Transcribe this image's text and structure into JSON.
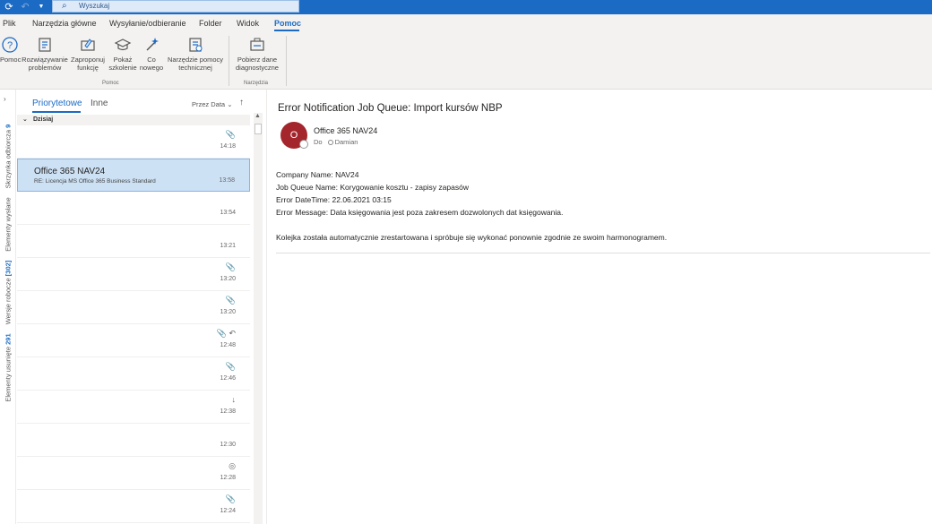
{
  "titlebar": {
    "search_placeholder": "Wyszukaj",
    "icons": [
      "sync-icon",
      "undo-icon",
      "qat-dropdown-icon"
    ]
  },
  "menu": {
    "tabs": [
      "Plik",
      "Narzędzia główne",
      "Wysyłanie/odbieranie",
      "Folder",
      "Widok",
      "Pomoc"
    ],
    "active": "Pomoc"
  },
  "ribbon": {
    "help_group_label": "Pomoc",
    "tools_group_label": "Narzędzia",
    "buttons": [
      {
        "line1": "Pomoc",
        "line2": ""
      },
      {
        "line1": "Rozwiązywanie",
        "line2": "problemów"
      },
      {
        "line1": "Zaproponuj",
        "line2": "funkcję"
      },
      {
        "line1": "Pokaż",
        "line2": "szkolenie"
      },
      {
        "line1": "Co",
        "line2": "nowego"
      },
      {
        "line1": "Narzędzie pomocy",
        "line2": "technicznej"
      },
      {
        "line1": "Pobierz dane",
        "line2": "diagnostyczne"
      }
    ]
  },
  "leftnav": {
    "inbox_label": "Skrzynka odbiorcza",
    "inbox_count": "9",
    "sent_label": "Elementy wysłane",
    "drafts_label": "Wersje robocze",
    "drafts_count": "[302]",
    "deleted_label": "Elementy usunięte",
    "deleted_count": "291"
  },
  "list": {
    "tab_focused": "Priorytetowe",
    "tab_other": "Inne",
    "sort_label": "Przez Data",
    "group_today": "Dzisiaj",
    "messages": [
      {
        "sender": "",
        "subject": "",
        "time": "14:18",
        "icons": "📎"
      },
      {
        "sender": "Office 365 NAV24",
        "subject": "RE: Licencja MS Office 365 Business Standard",
        "time": "13:58",
        "icons": ""
      },
      {
        "sender": "",
        "subject": "",
        "time": "13:54",
        "icons": ""
      },
      {
        "sender": "",
        "subject": "",
        "time": "13:21",
        "icons": ""
      },
      {
        "sender": "",
        "subject": "",
        "time": "13:20",
        "icons": "📎"
      },
      {
        "sender": "",
        "subject": "",
        "time": "13:20",
        "icons": "📎"
      },
      {
        "sender": "",
        "subject": "",
        "time": "12:48",
        "icons": "📎 ↶"
      },
      {
        "sender": "",
        "subject": "",
        "time": "12:46",
        "icons": "📎"
      },
      {
        "sender": "",
        "subject": "",
        "time": "12:38",
        "icons": "↓"
      },
      {
        "sender": "",
        "subject": "",
        "time": "12:30",
        "icons": ""
      },
      {
        "sender": "",
        "subject": "",
        "time": "12:28",
        "icons": "◎"
      },
      {
        "sender": "",
        "subject": "",
        "time": "12:24",
        "icons": "📎"
      }
    ]
  },
  "reading": {
    "subject": "Error Notification Job Queue: Import kursów NBP",
    "avatar_initial": "O",
    "from": "Office 365 NAV24",
    "to_label": "Do",
    "to_name": "Damian",
    "body": [
      "Company Name: NAV24",
      "Job Queue Name: Korygowanie kosztu - zapisy zapasów",
      "Error DateTime: 22.06.2021 03:15",
      "Error Message: Data księgowania jest poza zakresem dozwolonych dat księgowania.",
      "Kolejka została automatycznie zrestartowana i spróbuje się wykonać ponownie zgodnie ze swoim harmonogramem."
    ]
  },
  "colors": {
    "accent": "#1b6bc4",
    "avatar": "#a4262c",
    "selected_row": "#cde1f5"
  }
}
